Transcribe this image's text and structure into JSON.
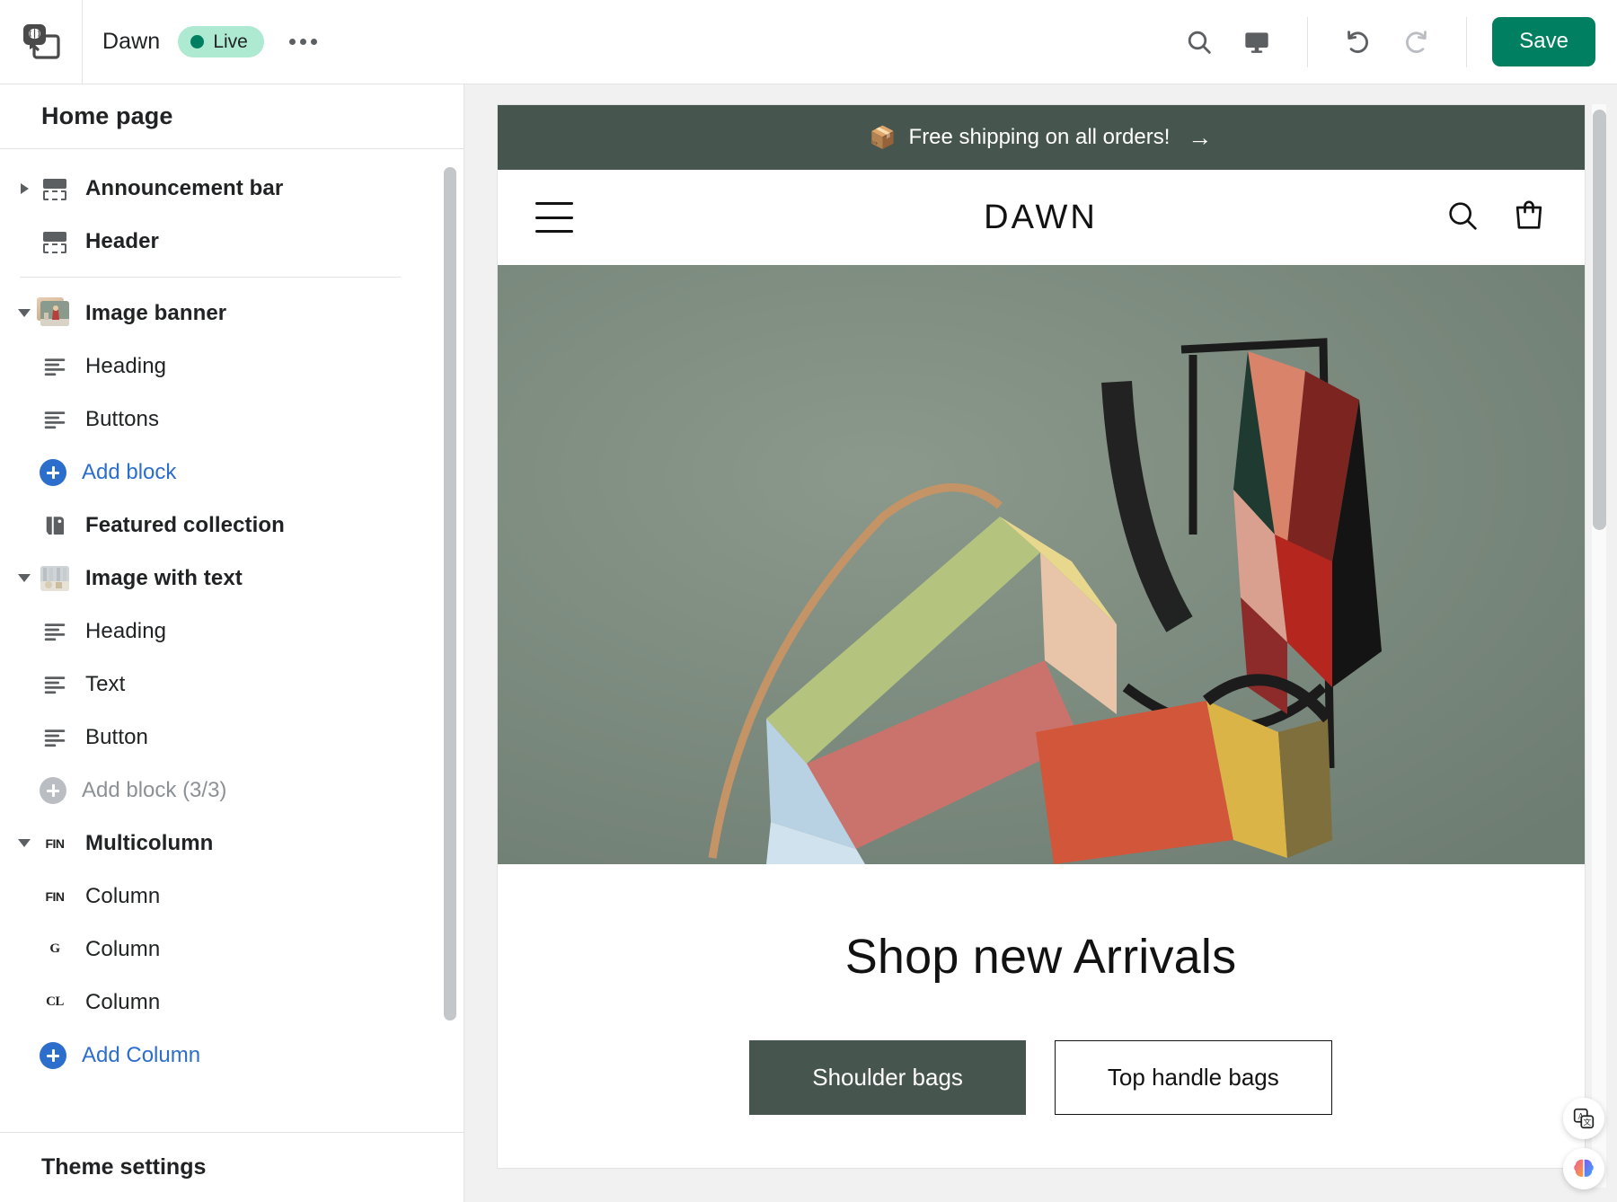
{
  "topbar": {
    "app_icon": "brain-screen-icon",
    "theme_name": "Dawn",
    "status_label": "Live",
    "more_label": "more-actions",
    "search_icon": "search-icon",
    "device_icon": "desktop-icon",
    "undo_icon": "undo-icon",
    "redo_icon": "redo-icon",
    "save_label": "Save",
    "accent_green": "#008060",
    "badge_bg": "#aee9d1"
  },
  "sidebar": {
    "title": "Home page",
    "footer_label": "Theme settings",
    "groups": [
      {
        "items": [
          {
            "label": "Announcement bar",
            "icon": "section-icon",
            "type": "section",
            "caret": "right"
          },
          {
            "label": "Header",
            "icon": "section-icon",
            "type": "section",
            "caret": "none"
          }
        ]
      },
      {
        "items": [
          {
            "label": "Image banner",
            "icon": "image-thumbnail",
            "type": "section",
            "caret": "down"
          },
          {
            "label": "Heading",
            "icon": "text-lines-icon",
            "type": "block"
          },
          {
            "label": "Buttons",
            "icon": "text-lines-icon",
            "type": "block"
          },
          {
            "label": "Add block",
            "icon": "plus-circle-icon",
            "type": "add",
            "disabled": false
          },
          {
            "label": "Featured collection",
            "icon": "tag-icon",
            "type": "section",
            "caret": "none"
          },
          {
            "label": "Image with text",
            "icon": "image-thumbnail",
            "type": "section",
            "caret": "down"
          },
          {
            "label": "Heading",
            "icon": "text-lines-icon",
            "type": "block"
          },
          {
            "label": "Text",
            "icon": "text-lines-icon",
            "type": "block"
          },
          {
            "label": "Button",
            "icon": "text-lines-icon",
            "type": "block"
          },
          {
            "label": "Add block (3/3)",
            "icon": "plus-circle-icon",
            "type": "add",
            "disabled": true
          },
          {
            "label": "Multicolumn",
            "icon": "logo-thumbnail",
            "type": "section",
            "caret": "down",
            "glyph": "FIN"
          },
          {
            "label": "Column",
            "icon": "logo-thumbnail",
            "type": "block",
            "glyph": "FIN"
          },
          {
            "label": "Column",
            "icon": "logo-thumbnail",
            "type": "block",
            "glyph": "G"
          },
          {
            "label": "Column",
            "icon": "logo-thumbnail",
            "type": "block",
            "glyph": "CL"
          },
          {
            "label": "Add Column",
            "icon": "plus-circle-icon",
            "type": "add",
            "disabled": false
          }
        ]
      }
    ]
  },
  "preview": {
    "announcement": {
      "emoji": "📦",
      "text": "Free shipping on all orders!",
      "arrow": "→",
      "bg": "#47554f"
    },
    "store_header": {
      "menu_icon": "hamburger-menu-icon",
      "brand": "DAWN",
      "search_icon": "search-icon",
      "cart_icon": "cart-icon"
    },
    "hero": {
      "alt": "colorful geometric leather handbags on sage green background",
      "bg": "#7d8c80"
    },
    "promo": {
      "heading": "Shop new Arrivals",
      "primary_button": "Shoulder bags",
      "secondary_button": "Top handle bags",
      "primary_bg": "#47554f"
    }
  },
  "floating": [
    {
      "icon": "translate-icon",
      "name": "translate-button"
    },
    {
      "icon": "brain-icon",
      "name": "ai-assistant-button"
    }
  ]
}
